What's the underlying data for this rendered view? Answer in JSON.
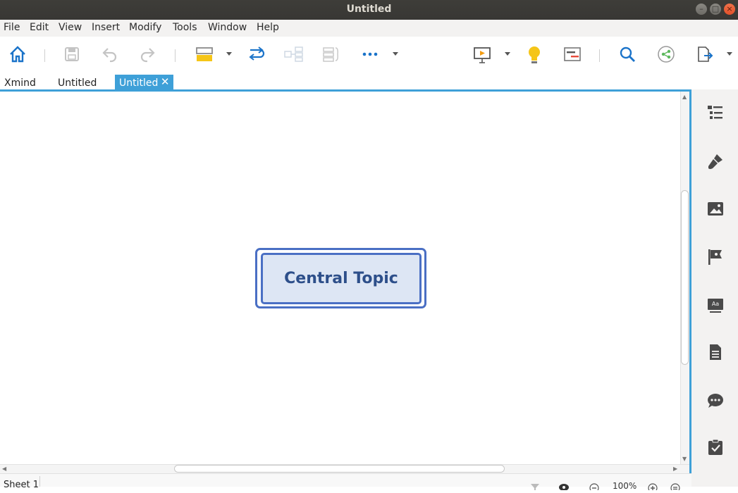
{
  "window": {
    "title": "Untitled"
  },
  "menu": [
    "File",
    "Edit",
    "View",
    "Insert",
    "Modify",
    "Tools",
    "Window",
    "Help"
  ],
  "toolbar": {
    "icons": [
      "home-icon",
      "save-icon",
      "undo-icon",
      "redo-icon",
      "topic-style-icon",
      "relationship-icon",
      "summary-structure-icon",
      "boundary-icon",
      "more-icon",
      "presentation-icon",
      "idea-bulb-icon",
      "gantt-icon",
      "search-icon",
      "share-icon",
      "export-icon"
    ]
  },
  "tabs": [
    {
      "label": "Xmind"
    },
    {
      "label": "Untitled"
    },
    {
      "label": "Untitled",
      "active": true,
      "close": "✕"
    }
  ],
  "canvas": {
    "central_topic": "Central Topic",
    "topic_fill": "#dde6f4",
    "topic_border": "#4a6fc4",
    "topic_text_color": "#2d4f8a"
  },
  "statusbar": {
    "sheet": "Sheet 1",
    "zoom": "100%"
  },
  "right_panel": {
    "icons": [
      "outline-icon",
      "format-brush-icon",
      "image-icon",
      "marker-flag-icon",
      "text-style-icon",
      "notes-icon",
      "comments-icon",
      "task-icon"
    ]
  },
  "colors": {
    "accent": "#3ea0d8",
    "toolbar_blue": "#1a73c9"
  }
}
